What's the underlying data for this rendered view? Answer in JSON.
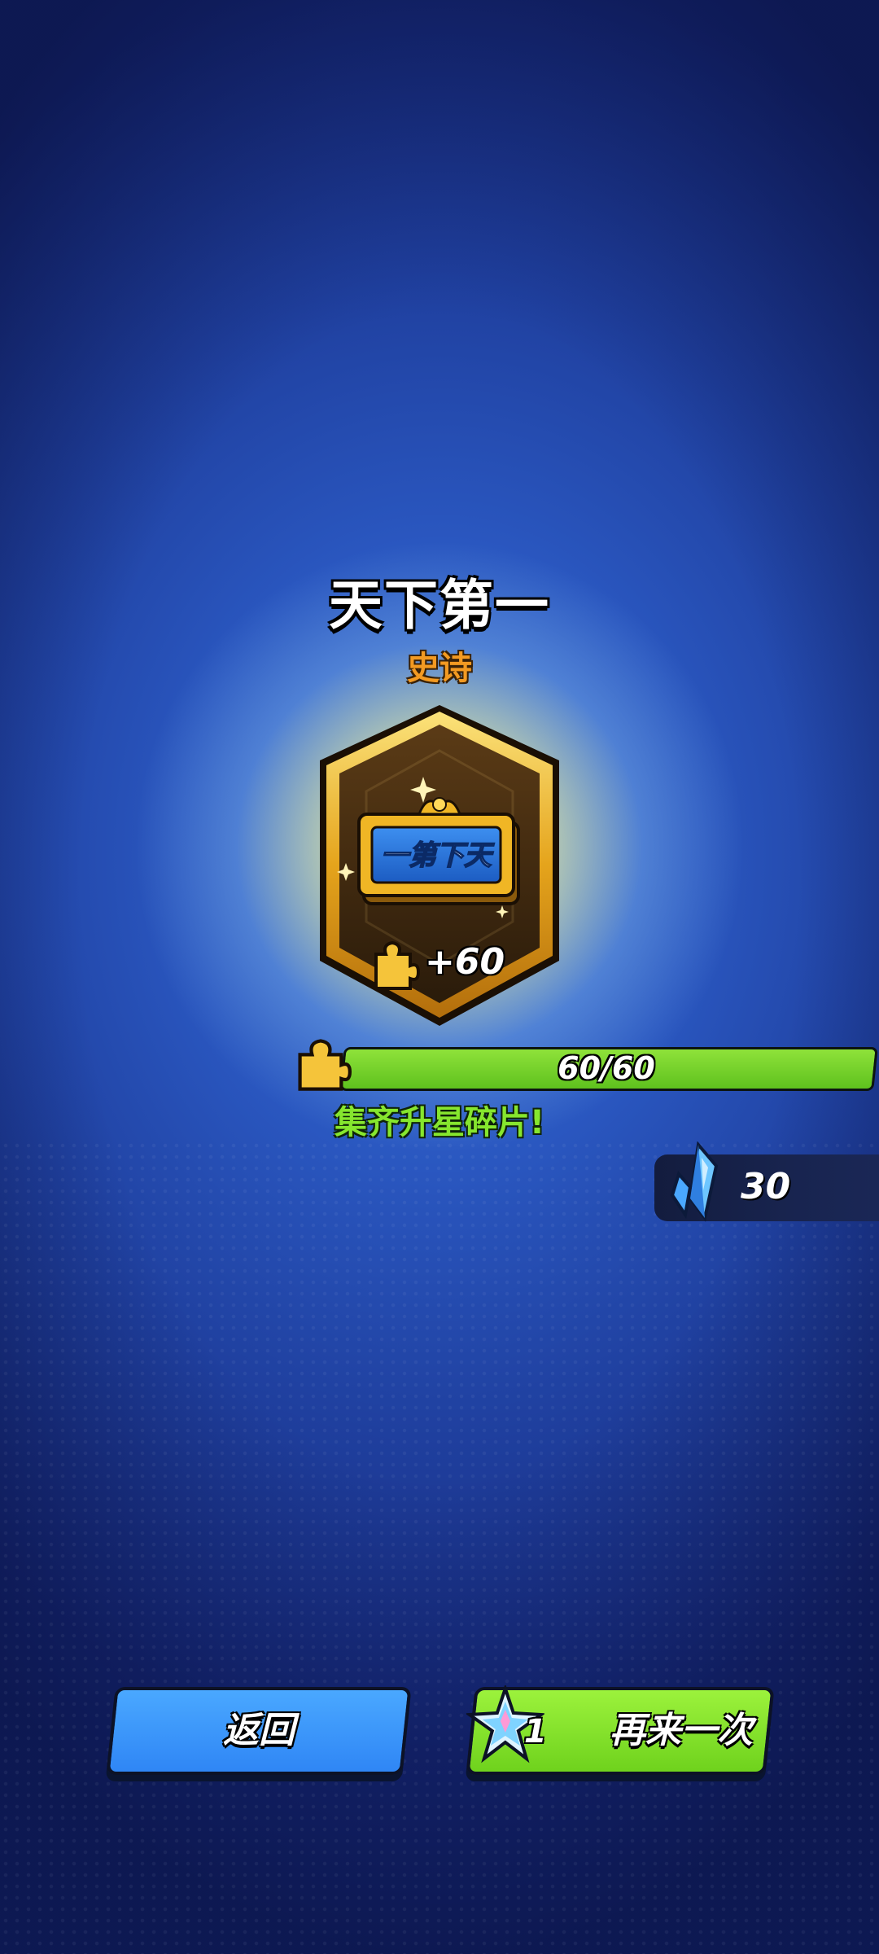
{
  "reward": {
    "title": "天下第一",
    "rarity": "史诗",
    "rarity_color": "#f39a22",
    "plaque_text": "一第下天",
    "card_icon": "golden-plaque-icon",
    "shard_icon": "puzzle-piece-icon",
    "shard_gain": "+60"
  },
  "progress": {
    "text": "60/60",
    "current": 60,
    "max": 60,
    "fill_fraction": 1.0,
    "fill_color": "#6fd21d",
    "message": "集齐升星碎片!"
  },
  "currency": {
    "icon": "blue-crystal-icon",
    "value": "30"
  },
  "buttons": {
    "back_label": "返回",
    "back_color": "#3a96fa",
    "retry_label": "再来一次",
    "retry_color": "#7ddc26",
    "retry_cost_icon": "star-ticket-icon",
    "retry_cost": "1"
  }
}
